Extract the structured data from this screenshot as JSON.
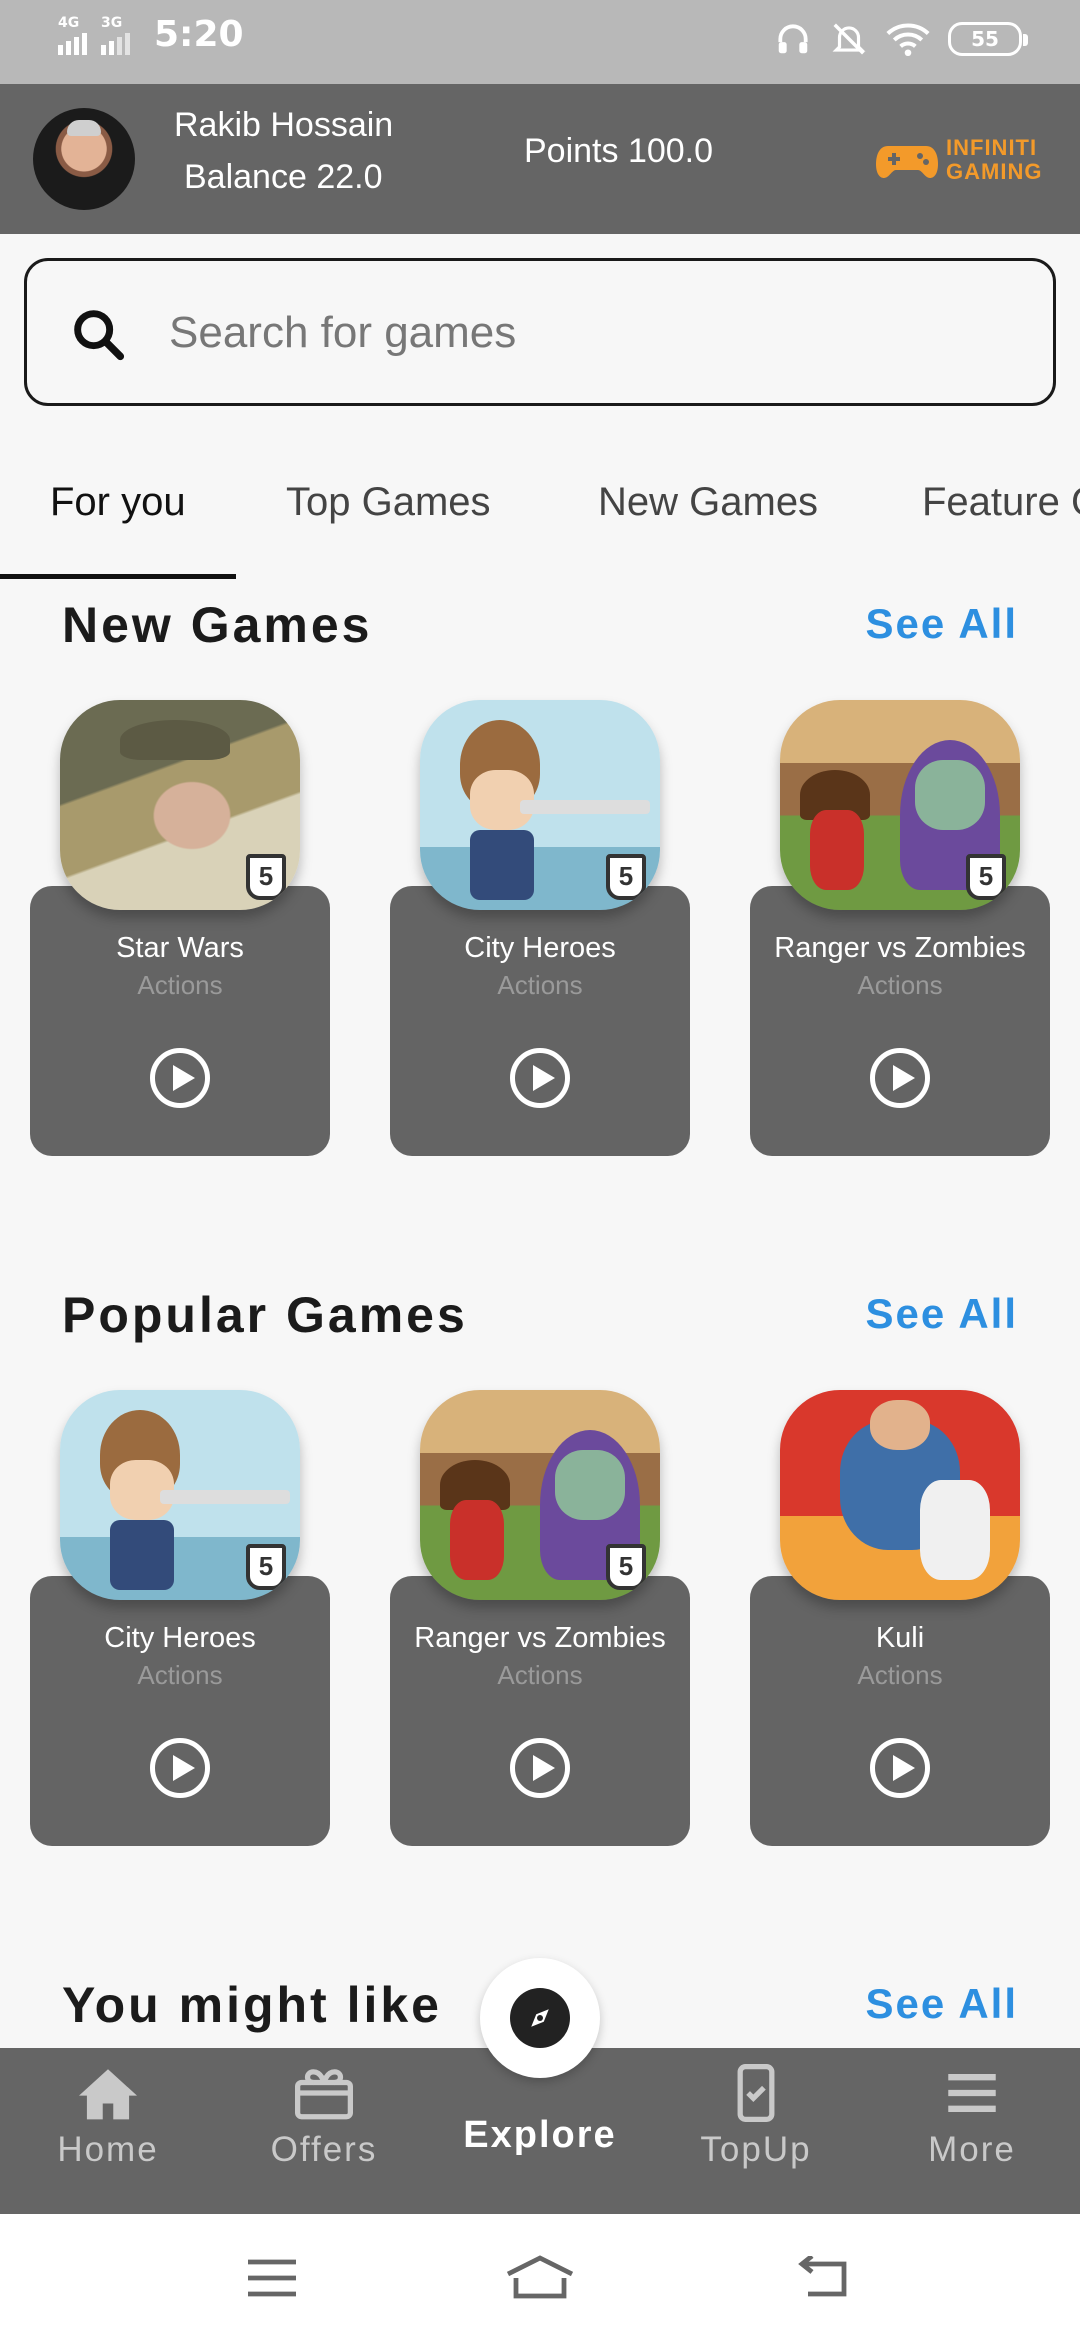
{
  "status_bar": {
    "time": "5:20",
    "network1": "4G",
    "network2": "3G",
    "battery": "55"
  },
  "header": {
    "user_name": "Rakib Hossain",
    "balance": "Balance 22.0",
    "points": "Points 100.0",
    "logo_line1": "INFINITI",
    "logo_line2": "GAMING",
    "logo_color": "#f39a2a"
  },
  "search": {
    "placeholder": "Search for games"
  },
  "tabs": [
    {
      "label": "For you",
      "active": true
    },
    {
      "label": "Top Games"
    },
    {
      "label": "New Games"
    },
    {
      "label": "Feature G"
    }
  ],
  "sections": {
    "new_games": {
      "title": "New Games",
      "see_all": "See All",
      "games": [
        {
          "title": "Star Wars",
          "category": "Actions",
          "badge": "5"
        },
        {
          "title": "City Heroes",
          "category": "Actions",
          "badge": "5"
        },
        {
          "title": "Ranger vs Zombies",
          "category": "Actions",
          "badge": "5"
        }
      ]
    },
    "popular_games": {
      "title": "Popular Games",
      "see_all": "See All",
      "games": [
        {
          "title": "City Heroes",
          "category": "Actions",
          "badge": "5"
        },
        {
          "title": "Ranger vs Zombies",
          "category": "Actions",
          "badge": "5"
        },
        {
          "title": "Kuli",
          "category": "Actions"
        }
      ]
    },
    "you_might_like": {
      "title": "You might like",
      "see_all": "See All"
    }
  },
  "bottom_nav": [
    {
      "label": "Home",
      "icon": "home-icon"
    },
    {
      "label": "Offers",
      "icon": "gift-icon"
    },
    {
      "label": "Explore",
      "icon": "compass-icon",
      "active": true
    },
    {
      "label": "TopUp",
      "icon": "phone-topup-icon"
    },
    {
      "label": "More",
      "icon": "menu-icon"
    }
  ],
  "colors": {
    "header_bg": "#656565",
    "accent": "#2d8fe0",
    "card_bg": "#646464"
  }
}
